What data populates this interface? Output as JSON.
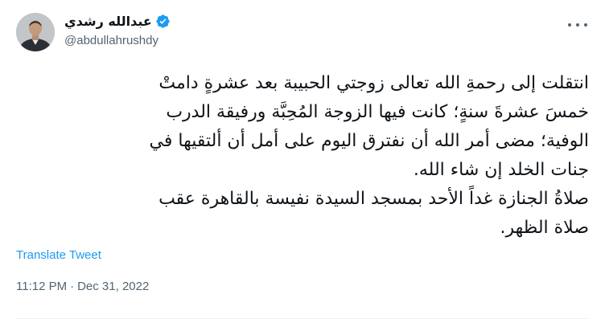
{
  "author": {
    "display_name": "عبدالله رشدي",
    "handle": "@abdullahrushdy",
    "verified": true
  },
  "tweet": {
    "lines": [
      "انتقلت إلى رحمةِ الله تعالى زوجتي الحبيبة بعد عشرةٍ دامتْ",
      "خمسَ عشرةَ سنةٍ؛ كانت فيها الزوجة المُحِبَّة ورفيقة الدرب",
      "الوفية؛ مضى أمر الله أن نفترق اليوم على أمل أن ألتقيها في",
      "جنات الخلد إن شاء الله.",
      "صلاةُ الجنازة غداً الأحد بمسجد السيدة نفيسة بالقاهرة عقب",
      "صلاة الظهر."
    ]
  },
  "translate_label": "Translate Tweet",
  "timestamp": {
    "time": "11:12 PM",
    "separator": "·",
    "date": "Dec 31, 2022"
  },
  "colors": {
    "accent": "#1d9bf0",
    "secondary_text": "#536471",
    "text": "#0f1419"
  },
  "icons": {
    "verified": "verified-badge-icon",
    "more": "more-dots-icon"
  }
}
